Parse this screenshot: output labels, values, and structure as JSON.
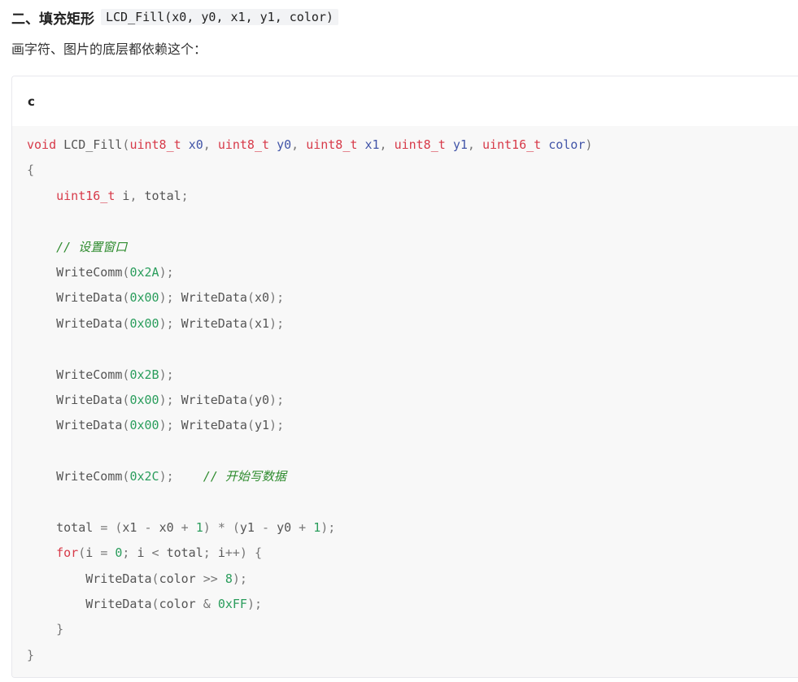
{
  "heading": {
    "title": "二、填充矩形",
    "inline_code": "LCD_Fill(x0, y0, x1, y1, color)"
  },
  "intro": "画字符、图片的底层都依赖这个：",
  "code_block": {
    "language": "c",
    "lines": [
      "void LCD_Fill(uint8_t x0, uint8_t y0, uint8_t x1, uint8_t y1, uint16_t color)",
      "{",
      "    uint16_t i, total;",
      "",
      "    // 设置窗口",
      "    WriteComm(0x2A);",
      "    WriteData(0x00); WriteData(x0);",
      "    WriteData(0x00); WriteData(x1);",
      "",
      "    WriteComm(0x2B);",
      "    WriteData(0x00); WriteData(y0);",
      "    WriteData(0x00); WriteData(y1);",
      "",
      "    WriteComm(0x2C);    // 开始写数据",
      "",
      "    total = (x1 - x0 + 1) * (y1 - y0 + 1);",
      "    for(i = 0; i < total; i++) {",
      "        WriteData(color >> 8);",
      "        WriteData(color & 0xFF);",
      "    }",
      "}"
    ]
  }
}
